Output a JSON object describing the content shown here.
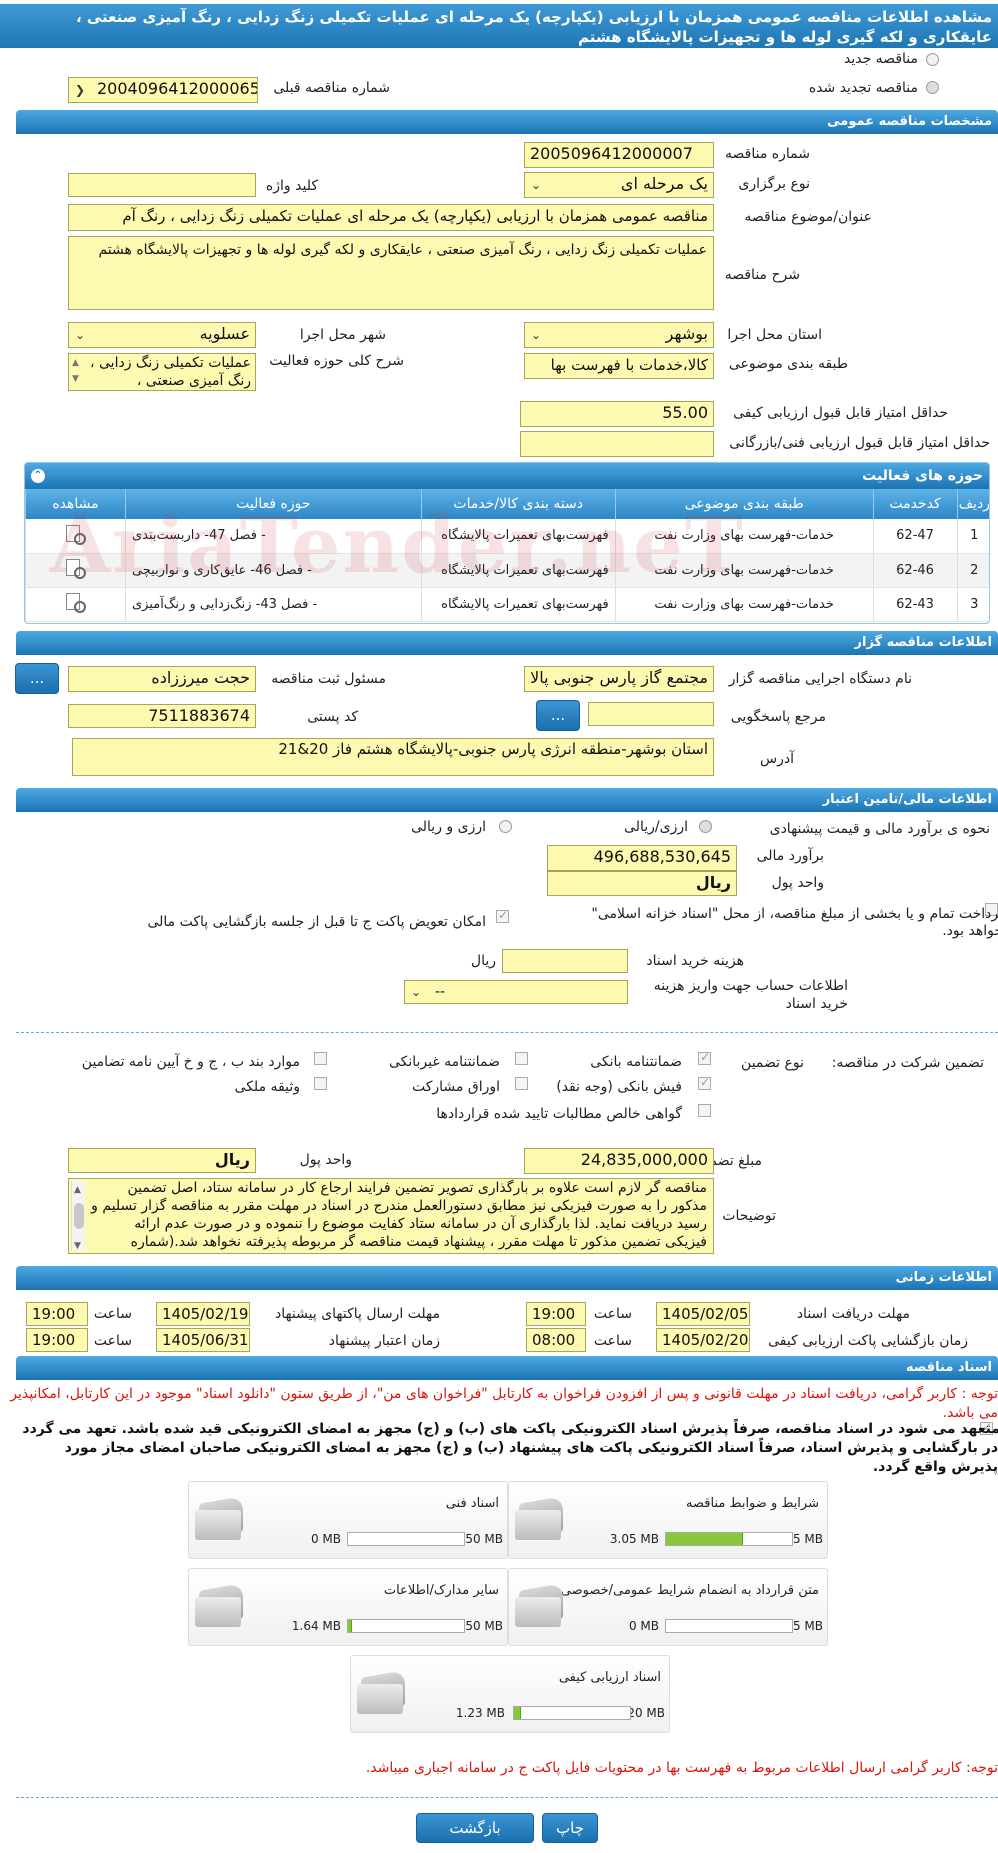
{
  "page": {
    "title": "مشاهده اطلاعات مناقصه عمومی همزمان با ارزیابی (یکپارچه) یک مرحله ای عملیات تکمیلی زنگ زدایی ، رنگ آمیزی صنعتی ، عایقکاری و لکه گیری لوله ها و تجهیزات پالایشگاه هشتم"
  },
  "tender_type": {
    "new_label": "مناقصه جدید",
    "renewed_label": "مناقصه تجدید شده",
    "prev_number_label": "شماره مناقصه قبلی",
    "prev_number_value": "2004096412000065"
  },
  "general": {
    "section_title": "مشخصات مناقصه عمومی",
    "number_label": "شماره مناقصه",
    "number_value": "2005096412000007",
    "holding_type_label": "نوع برگزاری",
    "holding_type_value": "یک مرحله ای",
    "keyword_label": "کلید واژه",
    "keyword_value": "",
    "subject_label": "عنوان/موضوع مناقصه",
    "subject_value": "مناقصه عمومی همزمان با ارزیابی (یکپارچه) یک مرحله ای عملیات تکمیلی زنگ زدایی ، رنگ آم",
    "description_label": "شرح مناقصه",
    "description_value": "عملیات تکمیلی زنگ زدایی ، رنگ آمیزی صنعتی ، عایقکاری و لکه گیری لوله ها و تجهیزات پالایشگاه هشتم",
    "province_label": "استان محل اجرا",
    "province_value": "بوشهر",
    "city_label": "شهر محل اجرا",
    "city_value": "عسلویه",
    "category_label": "طبقه بندی موضوعی",
    "category_value": "کالا،خدمات با فهرست بها",
    "activity_desc_label": "شرح کلی حوزه فعالیت",
    "activity_desc_value": "عملیات تکمیلی زنگ زدایی ، رنگ آمیزی صنعتی ،",
    "min_quality_label": "حداقل امتیاز قابل قبول ارزیابی کیفی",
    "min_quality_value": "55.00",
    "min_tech_label": "حداقل امتیاز قابل قبول ارزیابی فنی/بازرگانی",
    "min_tech_value": ""
  },
  "activities": {
    "title": "حوزه های فعالیت",
    "toggle_icon": "⌃",
    "headers": [
      "ردیف",
      "کدخدمت",
      "طبقه بندی موضوعی",
      "دسته بندی کالا/خدمات",
      "حوزه فعالیت",
      "مشاهده"
    ],
    "rows": [
      {
        "row": "1",
        "code": "62-47",
        "category": "خدمات-فهرست بهای وزارت نفت",
        "group": "فهرست‌بهای تعمیرات پالایشگاه",
        "field": "- فصل 47- داربست‌بندی"
      },
      {
        "row": "2",
        "code": "62-46",
        "category": "خدمات-فهرست بهای وزارت نفت",
        "group": "فهرست‌بهای تعمیرات پالایشگاه",
        "field": "- فصل 46- عایق‌کاری و نواربیچی"
      },
      {
        "row": "3",
        "code": "62-43",
        "category": "خدمات-فهرست بهای وزارت نفت",
        "group": "فهرست‌بهای تعمیرات پالایشگاه",
        "field": "- فصل 43- زنگ‌زدایی و رنگ‌آمیزی"
      }
    ],
    "watermark": "AriaTender.neT"
  },
  "organizer": {
    "section_title": "اطلاعات مناقصه گزار",
    "org_label": "نام دستگاه اجرایی مناقصه گزار",
    "org_value": "مجتمع گاز پارس جنوبی  پالا",
    "registrar_label": "مسئول ثبت مناقصه",
    "registrar_value": "حجت میرززاده",
    "reference_label": "مرجع پاسخگویی",
    "reference_value": "",
    "postal_label": "کد پستی",
    "postal_value": "7511883674",
    "address_label": "آدرس",
    "address_value": "استان بوشهر-منطقه انرژی پارس جنوبی-پالایشگاه هشتم فاز 20&21",
    "more_button": "..."
  },
  "finance": {
    "section_title": "اطلاعات مالی/تامین اعتبار",
    "estimate_method_label": "نحوه ی برآورد مالی و قیمت پیشنهادی",
    "option1_label": "ارزی/ریالی",
    "option2_label": "ارزی و ریالی",
    "estimate_label": "برآورد مالی",
    "estimate_value": "496,688,530,645",
    "currency_label": "واحد پول",
    "currency_value": "ریال",
    "treasury_label": "پرداخت تمام و یا بخشی از مبلغ مناقصه، از محل \"اسناد خزانه اسلامی\" خواهد بود.",
    "swap_label": "امکان تعویض پاکت ج تا قبل از جلسه بازگشایی پاکت مالی",
    "doc_fee_label": "هزینه خرید اسناد",
    "doc_fee_value": "",
    "doc_fee_unit": "ریال",
    "account_label": "اطلاعات حساب جهت واریز هزینه خرید اسناد",
    "account_value": "--"
  },
  "guarantee": {
    "participation_label": "تضمین شرکت در مناقصه:",
    "type_label": "نوع تضمین",
    "options": {
      "bank": "ضمانتنامه بانکی",
      "nonbank": "ضمانتنامه غیربانکی",
      "clauses": "موارد بند ب ، ج و خ آیین نامه تضامین",
      "receipt": "فیش بانکی (وجه نقد)",
      "bonds": "اوراق مشارکت",
      "property": "وثیقه ملکی",
      "certificate": "گواهی خالص مطالبات تایید شده قراردادها"
    },
    "amount_label": "مبلغ تضمین",
    "amount_value": "24,835,000,000",
    "currency_label": "واحد پول",
    "currency_value": "ریال",
    "notes_label": "توضیحات",
    "notes_value": "مناقصه گر لازم است علاوه بر بارگذاری تصویر تضمین فرایند ارجاع کار در سامانه ستاد، اصل تضمین مذکور را به صورت فیزیکی نیز مطابق دستورالعمل مندرج در اسناد در مهلت مقرر به مناقصه گزار تسلیم و رسید دریافت نماید. لذا بارگذاری آن در سامانه ستاد کفایت موضوع را ننموده و در صورت عدم ارائه فیزیکی تضمین مذکور تا مهلت مقرر ، پیشنهاد قیمت مناقصه گر مربوطه پذیرفته نخواهد شد.(شماره"
  },
  "timing": {
    "section_title": "اطلاعات زمانی",
    "doc_deadline_label": "مهلت دریافت اسناد",
    "doc_deadline_date": "1405/02/05",
    "doc_deadline_time": "19:00",
    "send_deadline_label": "مهلت ارسال پاکتهای پیشنهاد",
    "send_deadline_date": "1405/02/19",
    "send_deadline_time": "19:00",
    "opening_label": "زمان بازگشایی پاکت ارزیابی کیفی",
    "opening_date": "1405/02/20",
    "opening_time": "08:00",
    "validity_label": "زمان اعتبار پیشنهاد",
    "validity_date": "1405/06/31",
    "validity_time": "19:00",
    "time_label": "ساعت"
  },
  "documents": {
    "section_title": "اسناد مناقصه",
    "notice_red": "توجه : کاربر گرامی، دریافت اسناد در مهلت قانونی و پس از افزودن فراخوان به کارتابل \"فراخوان های من\"، از طریق ستون \"دانلود اسناد\" موجود در این کارتابل، امکانپذیر می باشد.",
    "commit_text": "متعهد می شود در اسناد مناقصه، صرفاً پذیرش اسناد الکترونیکی پاکت های (ب) و (ج) مجهز به امضای الکترونیکی قید شده باشد. تعهد می گردد در بارگشایی و پذیرش اسناد، صرفاً اسناد الکترونیکی پاکت های پیشنهاد (ب) و (ج) مجهز به امضای الکترونیکی صاحبان امضای مجاز مورد پذیرش واقع گردد.",
    "tiles": [
      {
        "title": "شرایط و ضوابط مناقصه",
        "current": "3.05 MB",
        "max": "5 MB",
        "ratio": 0.61
      },
      {
        "title": "اسناد فنی",
        "current": "0 MB",
        "max": "50 MB",
        "ratio": 0
      },
      {
        "title": "متن قرارداد به انضمام شرایط عمومی/خصوصی",
        "current": "0 MB",
        "max": "5 MB",
        "ratio": 0
      },
      {
        "title": "سایر مدارک/اطلاعات",
        "current": "1.64 MB",
        "max": "50 MB",
        "ratio": 0.033
      },
      {
        "title": "اسناد ارزیابی کیفی",
        "current": "1.23 MB",
        "max": "20 MB",
        "ratio": 0.062
      }
    ],
    "notice_bottom": "توجه: کاربر گرامی ارسال اطلاعات مربوط به فهرست بها در محتویات فایل پاکت ج در سامانه اجباری میباشد."
  },
  "footer": {
    "print_label": "چاپ",
    "back_label": "بازگشت"
  }
}
